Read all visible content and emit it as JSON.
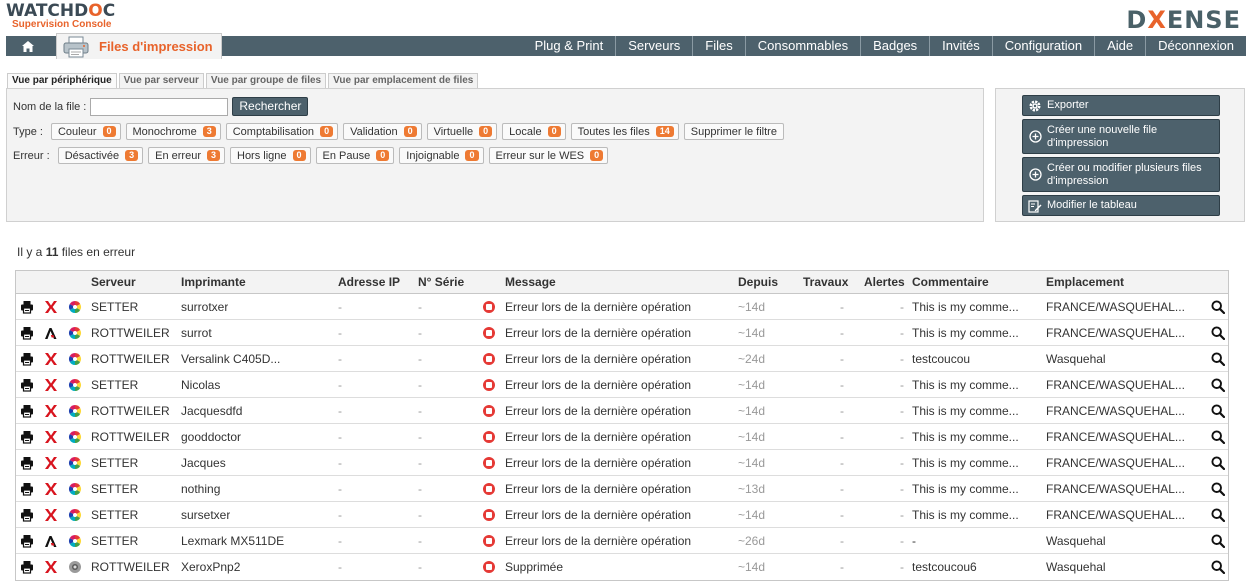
{
  "header": {
    "brand_main": "WATCHD",
    "brand_o": "O",
    "brand_end": "C",
    "brand_sub": "Supervision Console",
    "right_logo_a": "D",
    "right_logo_x": "X",
    "right_logo_b": "ENSE"
  },
  "nav": {
    "home_icon": "home-icon",
    "active_tab": "Files d'impression",
    "items": [
      "Plug & Print",
      "Serveurs",
      "Files",
      "Consommables",
      "Badges",
      "Invités",
      "Configuration",
      "Aide",
      "Déconnexion"
    ]
  },
  "view_tabs": [
    "Vue par périphérique",
    "Vue par serveur",
    "Vue par groupe de files",
    "Vue par emplacement de files"
  ],
  "filters": {
    "name_label": "Nom de la file :",
    "name_value": "",
    "search_label": "Rechercher",
    "type_label": "Type :",
    "types": [
      {
        "label": "Couleur",
        "count": "0"
      },
      {
        "label": "Monochrome",
        "count": "3"
      },
      {
        "label": "Comptabilisation",
        "count": "0"
      },
      {
        "label": "Validation",
        "count": "0"
      },
      {
        "label": "Virtuelle",
        "count": "0"
      },
      {
        "label": "Locale",
        "count": "0"
      },
      {
        "label": "Toutes les files",
        "count": "14"
      }
    ],
    "clear_label": "Supprimer le filtre",
    "error_label": "Erreur :",
    "errors": [
      {
        "label": "Désactivée",
        "count": "3"
      },
      {
        "label": "En erreur",
        "count": "3"
      },
      {
        "label": "Hors ligne",
        "count": "0"
      },
      {
        "label": "En Pause",
        "count": "0"
      },
      {
        "label": "Injoignable",
        "count": "0"
      },
      {
        "label": "Erreur sur le WES",
        "count": "0"
      }
    ]
  },
  "actions": {
    "export": "Exporter",
    "create_queue": "Créer une nouvelle file d'impression",
    "create_multi": "Créer ou modifier plusieurs files d'impression",
    "edit_table": "Modifier le tableau"
  },
  "count": {
    "prefix": "Il y a",
    "number": "11",
    "suffix": "files en erreur"
  },
  "table": {
    "columns": [
      "Serveur",
      "Imprimante",
      "Adresse IP",
      "N° Série",
      "Message",
      "Depuis",
      "Travaux",
      "Alertes",
      "Commentaire",
      "Emplacement"
    ],
    "rows": [
      {
        "brand": "xerox",
        "color": "color",
        "server": "SETTER",
        "printer": "surrotxer",
        "ip": "-",
        "serial": "-",
        "message": "Erreur lors de la dernière opération",
        "since": "~14d",
        "jobs": "-",
        "alerts": "-",
        "comment": "This is my comme...",
        "location": "FRANCE/WASQUEHAL..."
      },
      {
        "brand": "lexmark",
        "color": "color",
        "server": "ROTTWEILER",
        "printer": "surrot",
        "ip": "-",
        "serial": "-",
        "message": "Erreur lors de la dernière opération",
        "since": "~14d",
        "jobs": "-",
        "alerts": "-",
        "comment": "This is my comme...",
        "location": "FRANCE/WASQUEHAL..."
      },
      {
        "brand": "xerox",
        "color": "color",
        "server": "ROTTWEILER",
        "printer": "Versalink C405D...",
        "ip": "-",
        "serial": "-",
        "message": "Erreur lors de la dernière opération",
        "since": "~24d",
        "jobs": "-",
        "alerts": "-",
        "comment": "testcoucou",
        "location": "Wasquehal"
      },
      {
        "brand": "xerox",
        "color": "color",
        "server": "SETTER",
        "printer": "Nicolas",
        "ip": "-",
        "serial": "-",
        "message": "Erreur lors de la dernière opération",
        "since": "~14d",
        "jobs": "-",
        "alerts": "-",
        "comment": "This is my comme...",
        "location": "FRANCE/WASQUEHAL..."
      },
      {
        "brand": "xerox",
        "color": "color",
        "server": "ROTTWEILER",
        "printer": "Jacquesdfd",
        "ip": "-",
        "serial": "-",
        "message": "Erreur lors de la dernière opération",
        "since": "~14d",
        "jobs": "-",
        "alerts": "-",
        "comment": "This is my comme...",
        "location": "FRANCE/WASQUEHAL..."
      },
      {
        "brand": "xerox",
        "color": "color",
        "server": "ROTTWEILER",
        "printer": "gooddoctor",
        "ip": "-",
        "serial": "-",
        "message": "Erreur lors de la dernière opération",
        "since": "~14d",
        "jobs": "-",
        "alerts": "-",
        "comment": "This is my comme...",
        "location": "FRANCE/WASQUEHAL..."
      },
      {
        "brand": "xerox",
        "color": "color",
        "server": "SETTER",
        "printer": "Jacques",
        "ip": "-",
        "serial": "-",
        "message": "Erreur lors de la dernière opération",
        "since": "~14d",
        "jobs": "-",
        "alerts": "-",
        "comment": "This is my comme...",
        "location": "FRANCE/WASQUEHAL..."
      },
      {
        "brand": "xerox",
        "color": "color",
        "server": "SETTER",
        "printer": "nothing",
        "ip": "-",
        "serial": "-",
        "message": "Erreur lors de la dernière opération",
        "since": "~13d",
        "jobs": "-",
        "alerts": "-",
        "comment": "This is my comme...",
        "location": "FRANCE/WASQUEHAL..."
      },
      {
        "brand": "xerox",
        "color": "color",
        "server": "SETTER",
        "printer": "sursetxer",
        "ip": "-",
        "serial": "-",
        "message": "Erreur lors de la dernière opération",
        "since": "~14d",
        "jobs": "-",
        "alerts": "-",
        "comment": "This is my comme...",
        "location": "FRANCE/WASQUEHAL..."
      },
      {
        "brand": "lexmark",
        "color": "color",
        "server": "SETTER",
        "printer": "Lexmark MX511DE",
        "ip": "-",
        "serial": "-",
        "message": "Erreur lors de la dernière opération",
        "since": "~26d",
        "jobs": "-",
        "alerts": "-",
        "comment": "-",
        "location": "Wasquehal"
      },
      {
        "brand": "xerox",
        "color": "mono",
        "server": "ROTTWEILER",
        "printer": "XeroxPnp2",
        "ip": "-",
        "serial": "-",
        "message": "Supprimée",
        "since": "~14d",
        "jobs": "-",
        "alerts": "-",
        "comment": "testcoucou6",
        "location": "Wasquehal"
      }
    ]
  },
  "colors": {
    "accent": "#e8632b",
    "nav": "#4d616c",
    "badge": "#ee7a33",
    "error": "#e53935"
  }
}
